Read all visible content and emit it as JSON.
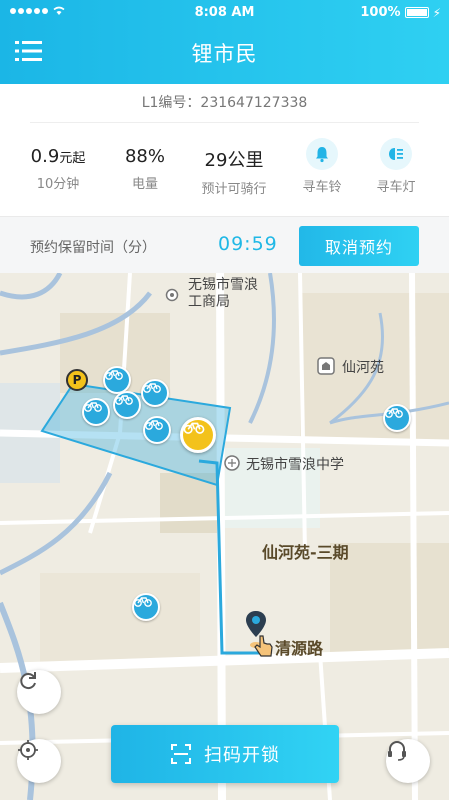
{
  "status_bar": {
    "time": "8:08 AM",
    "battery": "100%"
  },
  "header": {
    "title": "锂市民",
    "menu_icon": "menu-list-icon"
  },
  "bike": {
    "serial": "L1编号：231647127338"
  },
  "stats": [
    {
      "value_main": "0.9",
      "value_unit": "元起",
      "label": "10分钟"
    },
    {
      "value": "88%",
      "label": "电量"
    },
    {
      "value": "29公里",
      "label": "预计可骑行"
    }
  ],
  "tools": [
    {
      "icon": "bell-icon",
      "label": "寻车铃"
    },
    {
      "icon": "headlight-icon",
      "label": "寻车灯"
    }
  ],
  "reservation": {
    "label": "预约保留时间（分）",
    "timer": "09:59",
    "cancel_label": "取消预约"
  },
  "map": {
    "labels": {
      "bureau_line1": "无锡市雪浪",
      "bureau_line2": "工商局",
      "xianheyuan": "仙河苑",
      "school": "无锡市雪浪中学",
      "phase3": "仙河苑-三期",
      "road": "清源路"
    }
  },
  "actions": {
    "scan_label": "扫码开锁"
  },
  "colors": {
    "accent": "#20b8e6",
    "bike_marker": "#2ba9dd",
    "selected_bike": "#f3c21b"
  }
}
